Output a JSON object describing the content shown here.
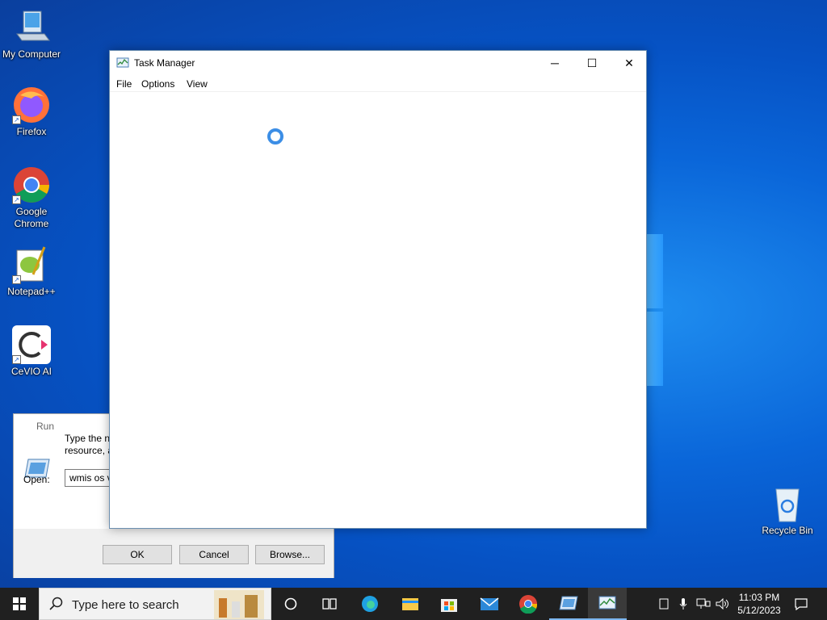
{
  "desktop": {
    "icons": [
      {
        "label": "My Computer"
      },
      {
        "label": "Firefox"
      },
      {
        "label": "Google Chrome"
      },
      {
        "label": "Notepad++"
      },
      {
        "label": "CeVIO AI"
      },
      {
        "label": "Recycle Bin"
      }
    ]
  },
  "task_manager": {
    "title": "Task Manager",
    "menu": [
      "File",
      "Options",
      "View"
    ],
    "minimize": "─",
    "maximize": "☐",
    "close": "✕",
    "status": "loading"
  },
  "run_dialog": {
    "title": "Run",
    "description_line1": "Type the na",
    "description_line2": "resource, a",
    "open_label": "Open:",
    "open_value": "wmis os v",
    "ok_label": "OK",
    "cancel_label": "Cancel",
    "browse_label": "Browse..."
  },
  "taskbar": {
    "search_placeholder": "Type here to search",
    "pinned": [
      "task-view",
      "edge",
      "file-explorer",
      "microsoft-store",
      "mail",
      "chrome",
      "run",
      "task-manager"
    ],
    "time": "11:03 PM",
    "date": "5/12/2023"
  },
  "colors": {
    "desktop": "#0a66d9",
    "taskbar": "#202020",
    "accent": "#3c8ee6"
  }
}
